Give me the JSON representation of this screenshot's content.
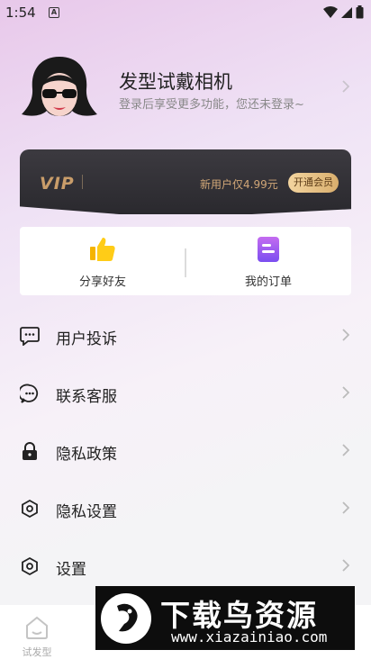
{
  "status_bar": {
    "time": "1:54",
    "sim_label": "A"
  },
  "profile": {
    "title": "发型试戴相机",
    "login_hint": "登录后享受更多功能，您还未登录~"
  },
  "vip": {
    "logo": "VIP",
    "price_text": "新用户仅4.99元",
    "button_label": "开通会员",
    "accent_color": "#c99d6a"
  },
  "quick_actions": [
    {
      "label": "分享好友",
      "icon": "thumbs-up-icon"
    },
    {
      "label": "我的订单",
      "icon": "order-icon"
    }
  ],
  "menu": [
    {
      "label": "用户投诉",
      "icon": "message-icon"
    },
    {
      "label": "联系客服",
      "icon": "chat-icon"
    },
    {
      "label": "隐私政策",
      "icon": "lock-icon"
    },
    {
      "label": "隐私设置",
      "icon": "settings-icon"
    },
    {
      "label": "设置",
      "icon": "settings-icon"
    }
  ],
  "tabbar": {
    "tab_label": "试发型"
  },
  "watermark": {
    "title": "下载鸟资源",
    "url": "www.xiazainiao.com"
  }
}
